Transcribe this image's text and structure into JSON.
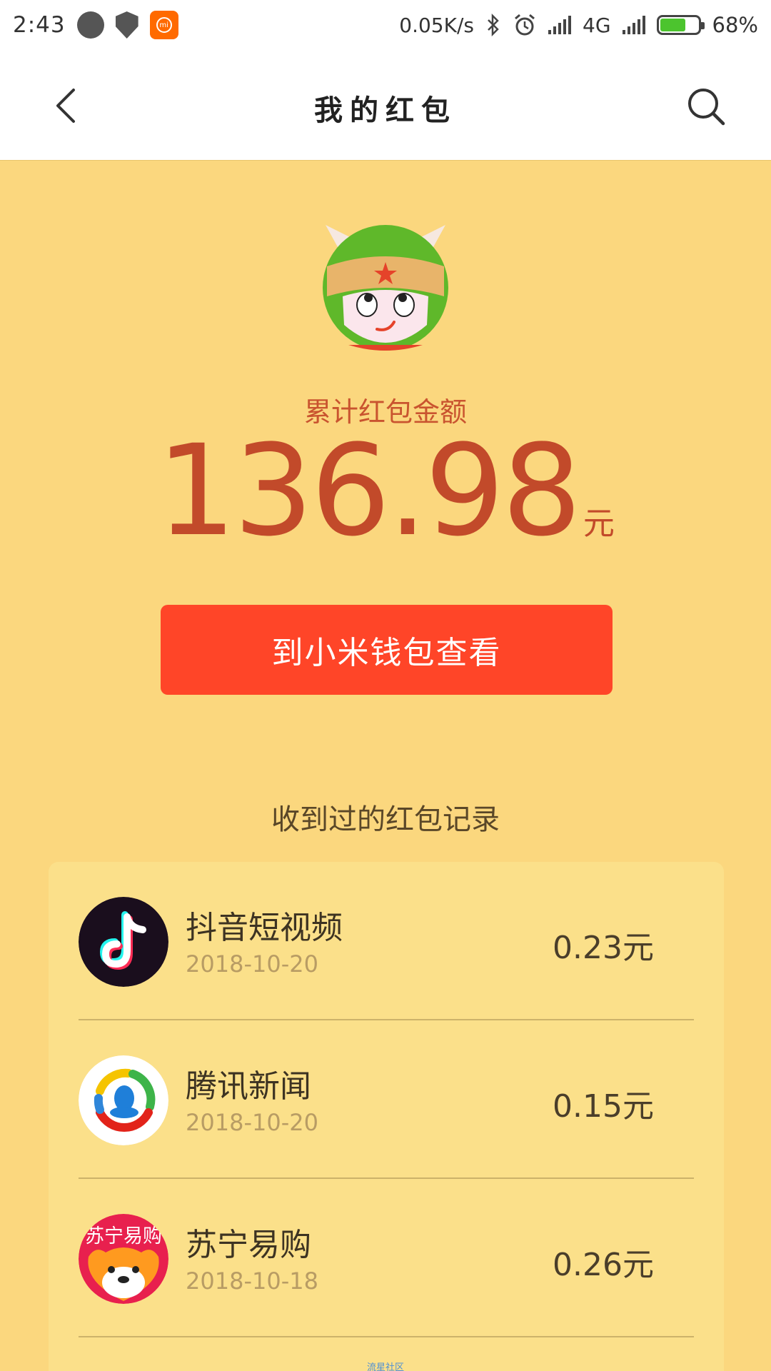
{
  "status_bar": {
    "time": "2:43",
    "net_speed": "0.05K/s",
    "network_type": "4G",
    "battery": "68%",
    "battery_level": 0.68,
    "icons": [
      "music-app-icon",
      "shield-icon",
      "mi-app-icon",
      "bluetooth-icon",
      "alarm-icon",
      "signal-icon",
      "battery-icon"
    ]
  },
  "nav": {
    "title": "我的红包",
    "back_icon": "chevron-left-icon",
    "search_icon": "search-icon"
  },
  "summary": {
    "label": "累计红包金额",
    "amount": "136.98",
    "unit": "元"
  },
  "wallet_button": {
    "label": "到小米钱包查看"
  },
  "records": {
    "title": "收到过的红包记录",
    "items": [
      {
        "name": "抖音短视频",
        "date": "2018-10-20",
        "amount": "0.23元",
        "icon": "douyin-icon"
      },
      {
        "name": "腾讯新闻",
        "date": "2018-10-20",
        "amount": "0.15元",
        "icon": "tencent-news-icon"
      },
      {
        "name": "苏宁易购",
        "date": "2018-10-18",
        "amount": "0.26元",
        "icon": "suning-icon",
        "icon_text": "苏宁易购"
      }
    ]
  },
  "watermark": "流星社区",
  "colors": {
    "background": "#fbd77e",
    "card": "#fbe08a",
    "accent": "#ff4528",
    "amount_text": "#c24a2a"
  }
}
